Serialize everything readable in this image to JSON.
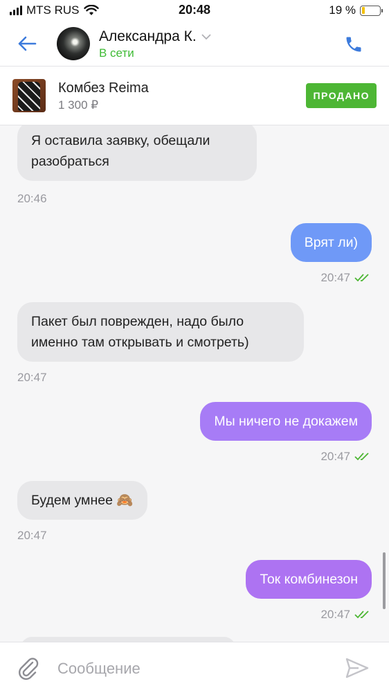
{
  "status_bar": {
    "carrier": "MTS RUS",
    "time": "20:48",
    "battery_percent": "19 %",
    "battery_level": 0.19
  },
  "header": {
    "contact_name": "Александра К.",
    "contact_status": "В сети",
    "status_color": "#3fbb35",
    "accent_color": "#3d7bdc"
  },
  "product": {
    "title": "Комбез Reima",
    "price": "1 300 ₽",
    "badge": "ПРОДАНО",
    "badge_color": "#4db634"
  },
  "messages": [
    {
      "direction": "in",
      "text": "Я оставила заявку, обещали разобраться",
      "time": "20:46"
    },
    {
      "direction": "out",
      "text": "Врят ли)",
      "time": "20:47",
      "read": true
    },
    {
      "direction": "in",
      "text": "Пакет был поврежден, надо было именно там открывать и смотреть)",
      "time": "20:47"
    },
    {
      "direction": "out",
      "text": "Мы ничего не докажем",
      "time": "20:47",
      "read": true
    },
    {
      "direction": "in",
      "text": "Будем умнее 🙈",
      "time": "20:47"
    },
    {
      "direction": "out",
      "text": "Ток комбинезон",
      "time": "20:47",
      "read": true
    }
  ],
  "composer": {
    "placeholder": "Сообщение",
    "icons": [
      "paperclip-icon",
      "send-icon"
    ]
  }
}
